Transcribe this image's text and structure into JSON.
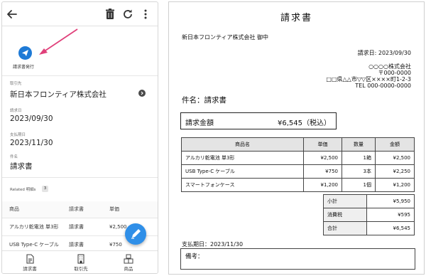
{
  "phone": {
    "issue_button_label": "請求書発行",
    "fields": {
      "client_label": "取引先",
      "client_value": "新日本フロンティア株式会社",
      "invoice_date_label": "請求日",
      "invoice_date_value": "2023/09/30",
      "due_date_label": "支払期日",
      "due_date_value": "2023/11/30",
      "subject_label": "件名",
      "subject_value": "請求書"
    },
    "related": {
      "label": "Related 明細s",
      "count": "3"
    },
    "table": {
      "headers": [
        "商品",
        "請求書",
        "単価"
      ],
      "rows": [
        [
          "アルカリ乾電池 単3形",
          "請求書",
          "¥2,500"
        ],
        [
          "USB Type-C ケーブル",
          "請求書",
          "¥750"
        ]
      ]
    },
    "bottom_nav": [
      {
        "label": "請求書",
        "icon": "document-icon"
      },
      {
        "label": "取引先",
        "icon": "building-icon"
      },
      {
        "label": "商品",
        "icon": "boxes-icon"
      }
    ],
    "accent_color": "#1e7ad6"
  },
  "invoice": {
    "title": "請求書",
    "recipient": "新日本フロンティア株式会社 御中",
    "issue_date": "請求日: 2023/09/30",
    "issuer": {
      "company": "○○○○株式会社",
      "postal": "〒000-0000",
      "address": "□□県△△市▽▽区××××町1-2-3",
      "tel": "TEL 000-0000-0000"
    },
    "subject": "件名：請求書",
    "amount_label": "請求金額",
    "amount_value": "¥6,545（税込）",
    "items_headers": [
      "商品名",
      "単価",
      "数量",
      "金額"
    ],
    "items": [
      [
        "アルカリ乾電池 単3形",
        "¥2,500",
        "1箱",
        "¥2,500"
      ],
      [
        "USB Type-C ケーブル",
        "¥750",
        "3本",
        "¥2,250"
      ],
      [
        "スマートフォンケース",
        "¥1,200",
        "1個",
        "¥1,200"
      ]
    ],
    "totals": [
      [
        "小計",
        "¥5,950"
      ],
      [
        "消費税",
        "¥595"
      ],
      [
        "合計",
        "¥6,545"
      ]
    ],
    "due": "支払期日：2023/11/30",
    "remarks_label": "備考："
  }
}
